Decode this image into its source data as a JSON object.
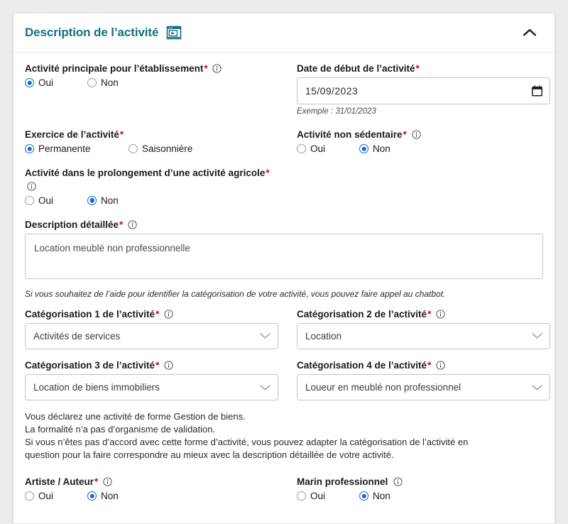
{
  "card": {
    "title": "Description de l’activité",
    "video_icon": "video-tutorial-icon",
    "collapse_icon": "chevron-up-icon"
  },
  "fields": {
    "activite_principale": {
      "label": "Activité principale pour l’établissement",
      "required": "*",
      "info": "info-icon",
      "options": [
        {
          "label": "Oui",
          "checked": true
        },
        {
          "label": "Non",
          "checked": false
        }
      ]
    },
    "date_debut": {
      "label": "Date de début de l’activité",
      "required": "*",
      "value": "15/09/2023",
      "hint": "Exemple : 31/01/2023",
      "calendar_icon": "calendar-icon"
    },
    "exercice": {
      "label": "Exercice de l’activité",
      "required": "*",
      "options": [
        {
          "label": "Permanente",
          "checked": true
        },
        {
          "label": "Saisonnière",
          "checked": false
        }
      ]
    },
    "non_sedentaire": {
      "label": "Activité non sédentaire",
      "required": "*",
      "info": "info-icon",
      "options": [
        {
          "label": "Oui",
          "checked": false
        },
        {
          "label": "Non",
          "checked": true
        }
      ]
    },
    "prolongement_agricole": {
      "label": "Activité dans le prolongement d’une activité agricole",
      "required": "*",
      "info": "info-icon",
      "options": [
        {
          "label": "Oui",
          "checked": false
        },
        {
          "label": "Non",
          "checked": true
        }
      ]
    },
    "description_detaillee": {
      "label": "Description détaillée",
      "required": "*",
      "info": "info-icon",
      "value": "Location meublé non professionnelle",
      "placeholder": ""
    },
    "chatbot_note": "Si vous souhaitez de l’aide pour identifier la catégorisation de votre activité, vous pouvez faire appel au chatbot.",
    "categorisation_1": {
      "label": "Catégorisation 1 de l’activité",
      "required": "*",
      "info": "info-icon",
      "value": "Activités de services"
    },
    "categorisation_2": {
      "label": "Catégorisation 2 de l’activité",
      "required": "*",
      "info": "info-icon",
      "value": "Location"
    },
    "categorisation_3": {
      "label": "Catégorisation 3 de l’activité",
      "required": "*",
      "info": "info-icon",
      "value": "Location de biens immobiliers"
    },
    "categorisation_4": {
      "label": "Catégorisation 4 de l’activité",
      "required": "*",
      "info": "info-icon",
      "value": "Loueur en meublé non professionnel"
    },
    "declaration_paragraph": {
      "line1": "Vous déclarez une activité de forme Gestion de biens.",
      "line2": "La formalité n’a pas d’organisme de validation.",
      "line3": "Si vous n’êtes pas d’accord avec cette forme d’activité, vous pouvez adapter la catégorisation de l’activité en",
      "line4": "question pour la faire correspondre au mieux avec la description détaillée de votre activité."
    },
    "artiste_auteur": {
      "label": "Artiste / Auteur",
      "required": "*",
      "info": "info-icon",
      "options": [
        {
          "label": "Oui",
          "checked": false
        },
        {
          "label": "Non",
          "checked": true
        }
      ]
    },
    "marin_professionnel": {
      "label": "Marin professionnel",
      "required": "",
      "info": "info-icon",
      "options": [
        {
          "label": "Oui",
          "checked": false
        },
        {
          "label": "Non",
          "checked": true
        }
      ]
    }
  },
  "colors": {
    "title_teal": "#12707f",
    "required_red": "#d0021b",
    "radio_blue": "#1069d4",
    "page_bg": "#ececec",
    "card_bg": "#ffffff"
  }
}
